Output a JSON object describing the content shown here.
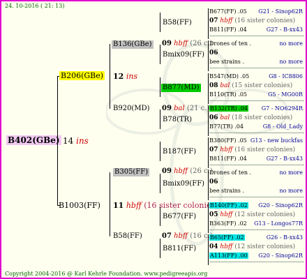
{
  "date_line": "24. 10-2016 ( 21: 13)",
  "root": {
    "name": "B402(GBe)",
    "gen": "14",
    "ins": "ins",
    "color": "#f0c8f0"
  },
  "g1": [
    {
      "name": "B206(GBe)",
      "gen": "12",
      "ins": "ins",
      "color": "#ffff00"
    },
    {
      "name": "B1003(FF)",
      "gen": "11",
      "hbff": "hbff",
      "sis": "(16 sister colonies)"
    }
  ],
  "g2": [
    {
      "name": "B136(GBe)",
      "gen": "09",
      "hbff": "hbff",
      "sis": "(26 c.)",
      "color": "#c0c0c0"
    },
    {
      "name": "B920(MD)",
      "gen": "09",
      "bal": "bal",
      "sis": "(21 c.)"
    },
    {
      "name": "B305(FF)",
      "gen": "09",
      "hbff": "hbff",
      "sis": "(26 c.)",
      "color": "#c0c0c0"
    },
    {
      "name": "B58(FF)",
      "gen": "07",
      "hbff": "hbff",
      "sis": "(16 c.)"
    }
  ],
  "g3": [
    {
      "name": "B58(FF)",
      "d1": "B677(FF) .05",
      "d1r": "G21 - Sinop62R",
      "g": "07",
      "tag": "hbff",
      "sis": "(16 sister colonies)",
      "d2": "B811(FF) .04",
      "d2r": "G27 - B-xx43"
    },
    {
      "name": "Bmix09(FF)",
      "d1": "Drones of ten .",
      "d1r": "no more",
      "g": "06",
      "tag": "",
      "sis": "",
      "d2": "bee strains .",
      "d2r": "no more"
    },
    {
      "name": "B877(MD)",
      "color": "#00cc00",
      "d1": "B547(MD) .05",
      "d1r": "G8 - IC8806",
      "g": "08",
      "tag": "bal",
      "sis": "(15 sister colonies)",
      "d2": "B110(TR) .05",
      "d2r": "G5 - MG00R"
    },
    {
      "name": "B78(TR)",
      "d1": "B132(TR) .04",
      "d1c": "#00cc00",
      "d1r": "G7 - NO6294R",
      "g": "06",
      "tag": "bal",
      "sis": "(18 sister colonies)",
      "d2": "B77(TR) .04",
      "d2r": "G8 - Old_Lady"
    },
    {
      "name": "B187(FF)",
      "d1": "B380(FF) .05",
      "d1r": "G13 - new buckfas",
      "g": "07",
      "tag": "hbff",
      "sis": "(16 sister colonies)",
      "d2": "B811(FF) .04",
      "d2r": "G27 - B-xx43"
    },
    {
      "name": "Bmix09(FF)",
      "d1": "Drones of ten .",
      "d1r": "no more",
      "g": "06",
      "tag": "",
      "sis": "",
      "d2": "bee strains .",
      "d2r": "no more"
    },
    {
      "name": "B677(FF)",
      "d1": "B140(FF) .02",
      "d1c": "#00e5e5",
      "d1r": "G20 - Sinop62R",
      "g": "05",
      "tag": "hbff",
      "sis": "(12 sister colonies)",
      "d2": "B363(FF) .02",
      "d2r": "G13 - Longos77R"
    },
    {
      "name": "B811(FF)",
      "d1": "B65(FF) .02",
      "d1c": "#00e5e5",
      "d1r": "G26 - B-xx43",
      "g": "04",
      "tag": "hbff",
      "sis": "(12 sister colonies)",
      "d2": "A113(FF) .00",
      "d2c": "#00e5e5",
      "d2r": "G20 - Sinop62R"
    }
  ],
  "footer": "Copyright 2004-2016 @ Karl Kehrle Foundation.   www.pedigreeapis.org"
}
